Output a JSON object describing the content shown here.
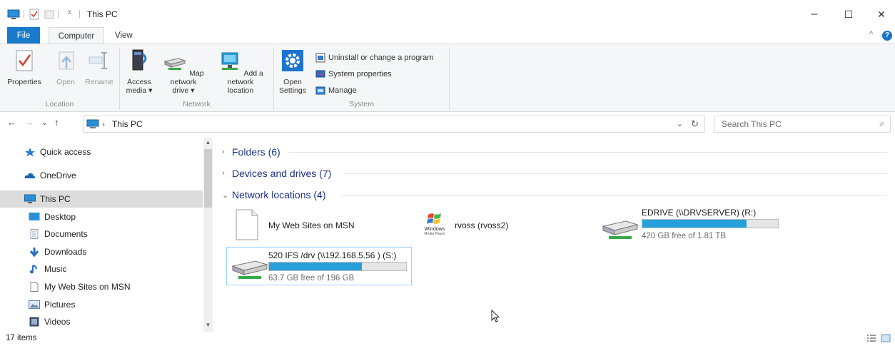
{
  "window": {
    "title": "This PC",
    "minimize_glyph": "–",
    "maximize_glyph": "☐",
    "close_glyph": "✕"
  },
  "ribbon_tabs": {
    "file": "File",
    "computer": "Computer",
    "view": "View",
    "collapse_glyph": "^",
    "help_glyph": "?"
  },
  "ribbon": {
    "location_group": {
      "label": "Location",
      "properties": "Properties",
      "open": "Open",
      "rename": "Rename"
    },
    "network_group": {
      "label": "Network",
      "access_media": [
        "Access",
        "media ▾"
      ],
      "map_network_drive": [
        "Map network",
        "drive ▾"
      ],
      "add_network_location": [
        "Add a network",
        "location"
      ]
    },
    "system_group": {
      "label": "System",
      "open_settings": [
        "Open",
        "Settings"
      ],
      "uninstall": "Uninstall or change a program",
      "system_properties": "System properties",
      "manage": "Manage"
    }
  },
  "address": {
    "back_glyph": "←",
    "forward_glyph": "→",
    "recent_glyph": "⌄",
    "up_glyph": "↑",
    "crumb_sep": "›",
    "crumb": "This PC",
    "dropdown_glyph": "⌄",
    "refresh_glyph": "↻",
    "search_placeholder": "Search This PC",
    "search_glyph": "⌕"
  },
  "nav_pane": {
    "items": [
      {
        "label": "Quick access",
        "icon": "star-icon",
        "color": "#2b7cd3"
      },
      {
        "label": "OneDrive",
        "icon": "cloud-icon",
        "color": "#1c64b4"
      },
      {
        "label": "This PC",
        "icon": "computer-icon",
        "color": "#2b8fd8",
        "selected": true
      },
      {
        "label": "Desktop",
        "icon": "desktop-icon",
        "color": "#2b8fd8"
      },
      {
        "label": "Documents",
        "icon": "document-icon",
        "color": "#8fa0b8"
      },
      {
        "label": "Downloads",
        "icon": "download-icon",
        "color": "#2a6fc9"
      },
      {
        "label": "Music",
        "icon": "music-icon",
        "color": "#2a6fc9"
      },
      {
        "label": "My Web Sites on MSN",
        "icon": "file-icon",
        "color": "#ffffff"
      },
      {
        "label": "Pictures",
        "icon": "pictures-icon",
        "color": "#5d7ea8"
      },
      {
        "label": "Videos",
        "icon": "videos-icon",
        "color": "#3c4c6a"
      }
    ],
    "scroll_up_glyph": "▲",
    "scroll_down_glyph": "▼"
  },
  "content": {
    "groups": [
      {
        "label": "Folders (6)",
        "chevron": "›"
      },
      {
        "label": "Devices and drives (7)",
        "chevron": "›"
      },
      {
        "label": "Network locations (4)",
        "chevron": "⌄"
      }
    ],
    "network_items": {
      "web_sites": {
        "label": "My Web Sites on MSN"
      },
      "rvoss": {
        "label": "rvoss (rvoss2)",
        "logo_text": "Windows",
        "logo_sub": "Media Player"
      },
      "edrive": {
        "label": "EDRIVE (\\\\DRVSERVER) (R:)",
        "free": "420 GB free of 1.81 TB",
        "used_fraction": 0.77
      },
      "s_drive": {
        "label": "520 IFS /drv (\\\\192.168.5.56   ) (S:)",
        "free": "63.7 GB free of 196 GB",
        "used_fraction": 0.675
      }
    }
  },
  "status": {
    "item_count": "17 items"
  },
  "colors": {
    "accent": "#1979ca",
    "bar_fill": "#26a0da",
    "group_heading": "#1e3287"
  }
}
